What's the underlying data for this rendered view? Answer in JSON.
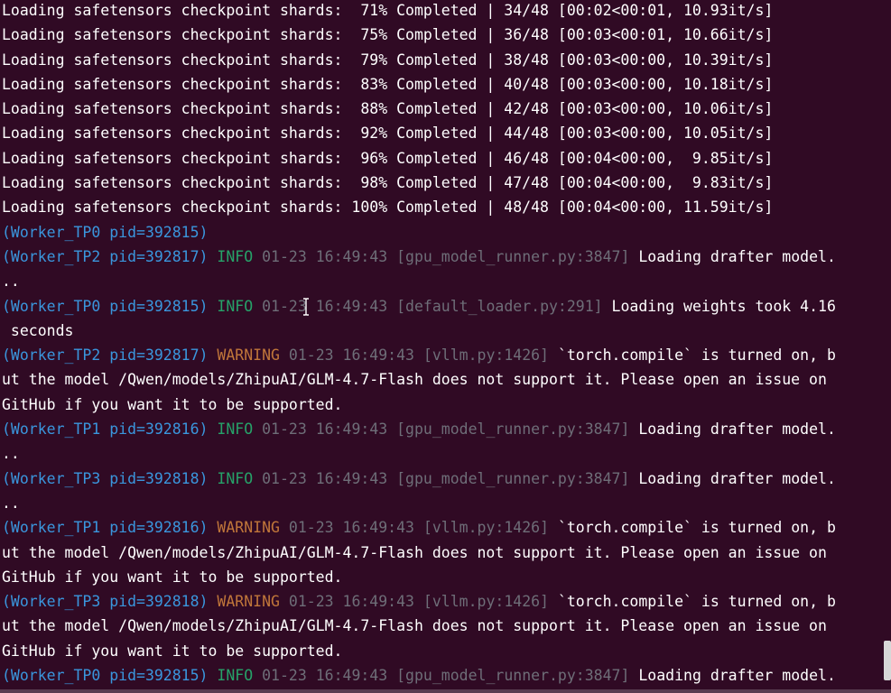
{
  "terminal": {
    "progress_lines": [
      "Loading safetensors checkpoint shards:  71% Completed | 34/48 [00:02<00:01, 10.93it/s]",
      "Loading safetensors checkpoint shards:  75% Completed | 36/48 [00:03<00:01, 10.66it/s]",
      "Loading safetensors checkpoint shards:  79% Completed | 38/48 [00:03<00:00, 10.39it/s]",
      "Loading safetensors checkpoint shards:  83% Completed | 40/48 [00:03<00:00, 10.18it/s]",
      "Loading safetensors checkpoint shards:  88% Completed | 42/48 [00:03<00:00, 10.06it/s]",
      "Loading safetensors checkpoint shards:  92% Completed | 44/48 [00:03<00:00, 10.05it/s]",
      "Loading safetensors checkpoint shards:  96% Completed | 46/48 [00:04<00:00,  9.85it/s]",
      "Loading safetensors checkpoint shards:  98% Completed | 47/48 [00:04<00:00,  9.83it/s]",
      "Loading safetensors checkpoint shards: 100% Completed | 48/48 [00:04<00:00, 11.59it/s]"
    ],
    "log": {
      "w0_line": "(Worker_TP0 pid=392815)",
      "e1": {
        "worker": "(Worker_TP2 pid=392817)",
        "level": "INFO",
        "time": "01-23 16:49:43",
        "src": "[gpu_model_runner.py:3847]",
        "msg": "Loading drafter model.",
        "cont": [
          ".."
        ]
      },
      "e2": {
        "worker": "(Worker_TP0 pid=392815)",
        "level": "INFO",
        "time": "01-23 16:49:43",
        "src": "[default_loader.py:291]",
        "msg": "Loading weights took 4.16",
        "cont": [
          " seconds"
        ]
      },
      "e3": {
        "worker": "(Worker_TP2 pid=392817)",
        "level": "WARNING",
        "time": "01-23 16:49:43",
        "src": "[vllm.py:1426]",
        "msg": "`torch.compile` is turned on, b",
        "cont": [
          "ut the model /Qwen/models/ZhipuAI/GLM-4.7-Flash does not support it. Please open an issue on",
          "GitHub if you want it to be supported."
        ]
      },
      "e4": {
        "worker": "(Worker_TP1 pid=392816)",
        "level": "INFO",
        "time": "01-23 16:49:43",
        "src": "[gpu_model_runner.py:3847]",
        "msg": "Loading drafter model.",
        "cont": [
          ".."
        ]
      },
      "e5": {
        "worker": "(Worker_TP3 pid=392818)",
        "level": "INFO",
        "time": "01-23 16:49:43",
        "src": "[gpu_model_runner.py:3847]",
        "msg": "Loading drafter model.",
        "cont": [
          ".."
        ]
      },
      "e6": {
        "worker": "(Worker_TP1 pid=392816)",
        "level": "WARNING",
        "time": "01-23 16:49:43",
        "src": "[vllm.py:1426]",
        "msg": "`torch.compile` is turned on, b",
        "cont": [
          "ut the model /Qwen/models/ZhipuAI/GLM-4.7-Flash does not support it. Please open an issue on",
          "GitHub if you want it to be supported."
        ]
      },
      "e7": {
        "worker": "(Worker_TP3 pid=392818)",
        "level": "WARNING",
        "time": "01-23 16:49:43",
        "src": "[vllm.py:1426]",
        "msg": "`torch.compile` is turned on, b",
        "cont": [
          "ut the model /Qwen/models/ZhipuAI/GLM-4.7-Flash does not support it. Please open an issue on",
          "GitHub if you want it to be supported."
        ]
      },
      "e8": {
        "worker": "(Worker_TP0 pid=392815)",
        "level": "INFO",
        "time": "01-23 16:49:43",
        "src": "[gpu_model_runner.py:3847]",
        "msg": "Loading drafter model.",
        "cont": []
      }
    }
  },
  "colors": {
    "background": "#300a24",
    "worker": "#3a96dd",
    "info": "#26a269",
    "warning": "#c0763a",
    "dim": "#6e6e78",
    "text": "#ffffff"
  },
  "icons": {
    "mouse_cursor": "text-cursor-icon"
  }
}
